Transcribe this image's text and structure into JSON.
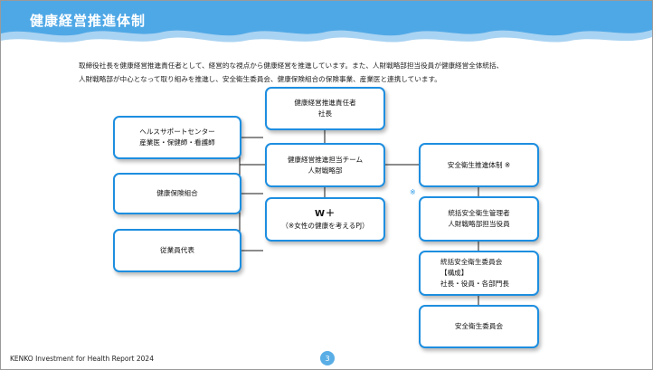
{
  "header": {
    "title": "健康経営推進体制"
  },
  "intro": {
    "line1": "取締役社長を健康経営推進責任者として、経営的な視点から健康経営を推進しています。また、人財戦略部担当役員が健康経営全体統括、",
    "line2": "人財戦略部が中心となって取り組みを推進し、安全衛生委員会、健康保険組合の保険事業、産業医と連携しています。"
  },
  "diagram": {
    "left": [
      {
        "lines": [
          "ヘルスサポートセンター",
          "産業医・保健師・看護師"
        ]
      },
      {
        "lines": [
          "健康保険組合"
        ]
      },
      {
        "lines": [
          "従業員代表"
        ]
      }
    ],
    "center": [
      {
        "lines": [
          "健康経営推進責任者",
          "社長"
        ]
      },
      {
        "lines": [
          "健康経営推進担当チーム",
          "人財戦略部"
        ]
      },
      {
        "lines": [
          "W＋",
          "（※女性の健康を考えるPJ）"
        ]
      }
    ],
    "right": [
      {
        "lines": [
          "安全衛生推進体制 ※"
        ]
      },
      {
        "lines": [
          "統括安全衛生管理者",
          "人財戦略部担当役員"
        ]
      },
      {
        "lines": [
          "統括安全衛生委員会",
          "【構成】",
          "社長・役員・各部門長"
        ]
      },
      {
        "lines": [
          "安全衛生委員会"
        ]
      }
    ],
    "footnote_mark": "※"
  },
  "footer": {
    "report_name": "KENKO Investment for Health Report 2024",
    "page_number": "3"
  },
  "colors": {
    "accent": "#1d8ee0",
    "header_wave": "#4fa8e6",
    "header_wave_light": "#a9d3f2"
  }
}
